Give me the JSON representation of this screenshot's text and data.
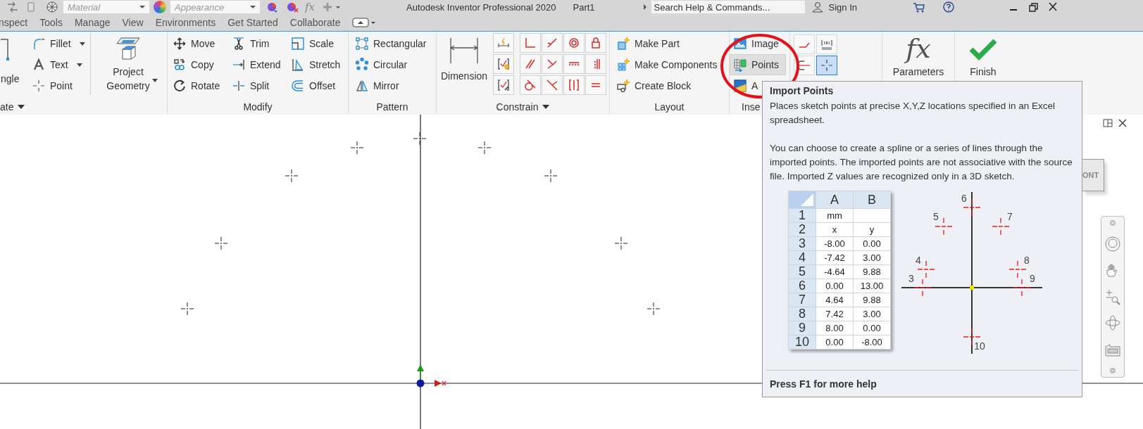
{
  "quick_access": {
    "material": "Material",
    "appearance": "Appearance",
    "parameters_symbol": "fx",
    "title": "Autodesk Inventor Professional 2020",
    "document": "Part1",
    "search": {
      "placeholder": "Search Help & Commands..."
    },
    "sign_in": "Sign In"
  },
  "tabs": [
    {
      "label": "nspect",
      "selected": false
    },
    {
      "label": "Tools",
      "selected": false
    },
    {
      "label": "Manage",
      "selected": false
    },
    {
      "label": "View",
      "selected": false
    },
    {
      "label": "Environments",
      "selected": false
    },
    {
      "label": "Get Started",
      "selected": false
    },
    {
      "label": "Collaborate",
      "selected": false
    }
  ],
  "ribbon": {
    "create": {
      "label": "ate",
      "dropdown": true,
      "shape_button": "ngle",
      "tools": [
        {
          "label": "Fillet",
          "dropdown": true
        },
        {
          "label": "Text",
          "dropdown": true
        },
        {
          "label": "Point",
          "dropdown": false
        }
      ],
      "project_geometry": {
        "label": "Project Geometry",
        "dropdown": true
      }
    },
    "modify": {
      "label": "Modify",
      "tools": [
        "Move",
        "Copy",
        "Rotate",
        "Trim",
        "Extend",
        "Split",
        "Scale",
        "Stretch",
        "Offset"
      ]
    },
    "pattern": {
      "label": "Pattern",
      "tools": [
        "Rectangular",
        "Circular",
        "Mirror"
      ]
    },
    "constrain": {
      "label": "Constrain",
      "dropdown": true,
      "dimension": "Dimension"
    },
    "layout": {
      "label": "Layout",
      "tools": [
        "Make Part",
        "Make Components",
        "Create Block"
      ]
    },
    "insert": {
      "label": "Inse",
      "tools": [
        {
          "label": "Image",
          "selected": false
        },
        {
          "label": "Points",
          "selected": true
        },
        {
          "label": "A",
          "selected": false
        }
      ]
    },
    "format": {
      "buttons": [
        {
          "selected": false
        },
        {
          "selected": false
        },
        {
          "selected": false
        },
        {
          "selected": true
        }
      ]
    },
    "parameters": {
      "symbol": "fx",
      "label": "Parameters"
    },
    "finish": {
      "label": "Finish"
    }
  },
  "canvas": {
    "viewcube_label": "ONT"
  },
  "tooltip": {
    "title": "Import Points",
    "description": "Places sketch points at precise X,Y,Z locations specified in an Excel spreadsheet.",
    "details": "You can choose to create a spline or a series of lines through the imported points. The imported points are not associative with the source file. Imported Z values are recognized only in a 3D sketch.",
    "spreadsheet": {
      "columns": [
        "A",
        "B"
      ],
      "rows": [
        {
          "number": "1",
          "a": "mm"
        },
        {
          "number": "2",
          "a": "x",
          "b": "y"
        },
        {
          "number": "3",
          "a": "-8.00",
          "b": "0.00"
        },
        {
          "number": "4",
          "a": "-7.42",
          "b": "3.00"
        },
        {
          "number": "5",
          "a": "-4.64",
          "b": "9.88"
        },
        {
          "number": "6",
          "a": "0.00",
          "b": "13.00"
        },
        {
          "number": "7",
          "a": "4.64",
          "b": "9.88"
        },
        {
          "number": "8",
          "a": "7.42",
          "b": "3.00"
        },
        {
          "number": "9",
          "a": "8.00",
          "b": "0.00"
        },
        {
          "number": "10",
          "a": "0.00",
          "b": "-8.00"
        }
      ]
    },
    "diagram": {
      "point_labels": [
        "3",
        "4",
        "5",
        "6",
        "7",
        "8",
        "9",
        "10"
      ]
    },
    "footer": "Press F1 for more help"
  }
}
